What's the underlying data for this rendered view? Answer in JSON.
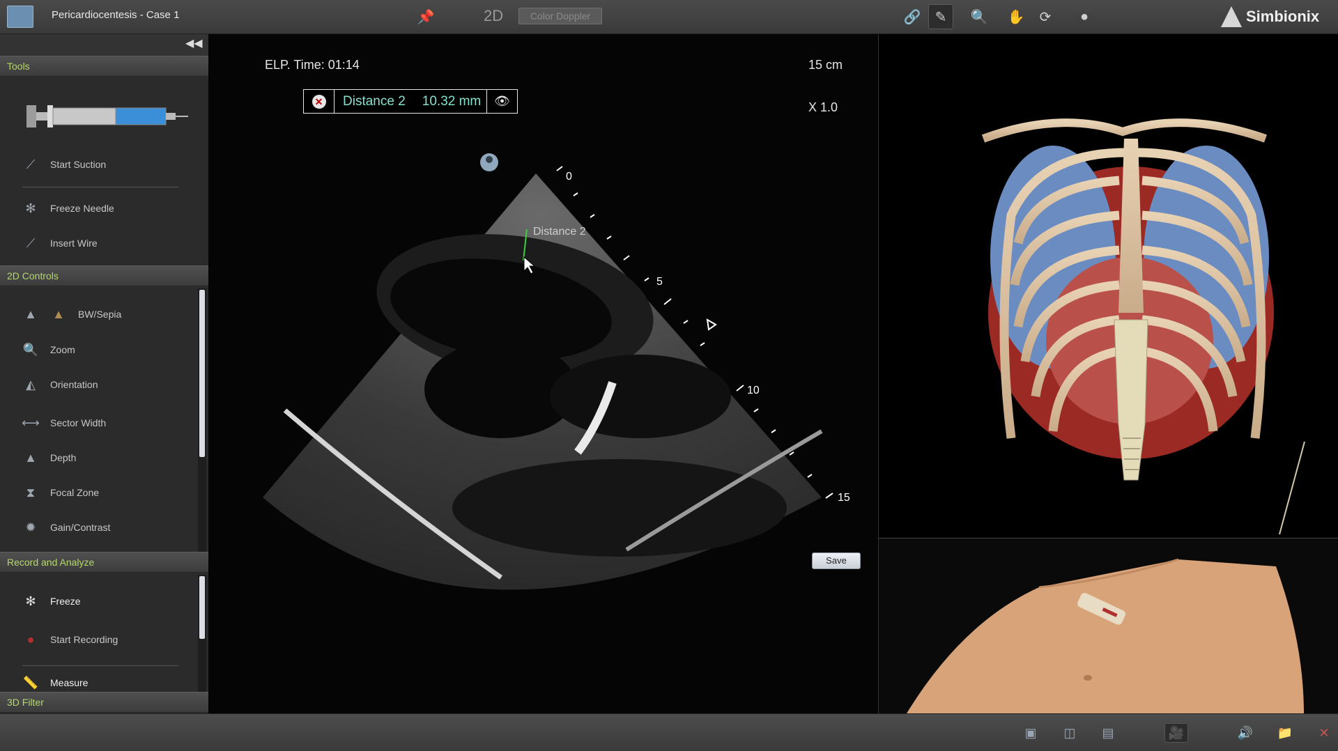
{
  "app": {
    "case_title": "Pericardiocentesis - Case 1",
    "brand": "Simbionix"
  },
  "toolbar": {
    "mode_label": "2D",
    "doppler_label": "Color Doppler"
  },
  "sidebar": {
    "tools_header": "Tools",
    "tools": [
      {
        "label": "Start Suction",
        "icon": "syringe-suction-icon"
      },
      {
        "label": "Freeze Needle",
        "icon": "snowflake-icon"
      },
      {
        "label": "Insert Wire",
        "icon": "wire-icon"
      }
    ],
    "controls_header": "2D Controls",
    "controls": [
      {
        "label": "BW/Sepia",
        "icon": "sector-icon"
      },
      {
        "label": "Zoom",
        "icon": "zoom-icon"
      },
      {
        "label": "Orientation",
        "icon": "orientation-icon"
      },
      {
        "label": "Sector Width",
        "icon": "sector-width-icon"
      },
      {
        "label": "Depth",
        "icon": "depth-icon"
      },
      {
        "label": "Focal Zone",
        "icon": "focal-zone-icon"
      },
      {
        "label": "Gain/Contrast",
        "icon": "gain-icon"
      }
    ],
    "record_header": "Record and Analyze",
    "record": [
      {
        "label": "Freeze",
        "icon": "snowflake-icon"
      },
      {
        "label": "Start Recording",
        "icon": "record-icon"
      },
      {
        "label": "Measure",
        "icon": "ruler-icon"
      }
    ],
    "filter_header": "3D Filter"
  },
  "ultrasound": {
    "elapsed_time": "ELP. Time: 01:14",
    "depth": "15 cm",
    "zoom": "X 1.0",
    "measurement": {
      "name": "Distance 2",
      "value": "10.32 mm"
    },
    "depth_ticks": [
      "0",
      "5",
      "10",
      "15"
    ],
    "save_label": "Save"
  },
  "colors": {
    "accent_green": "#b5d96b",
    "measure_text": "#86e0cf",
    "caliper": "#3ad13a"
  }
}
